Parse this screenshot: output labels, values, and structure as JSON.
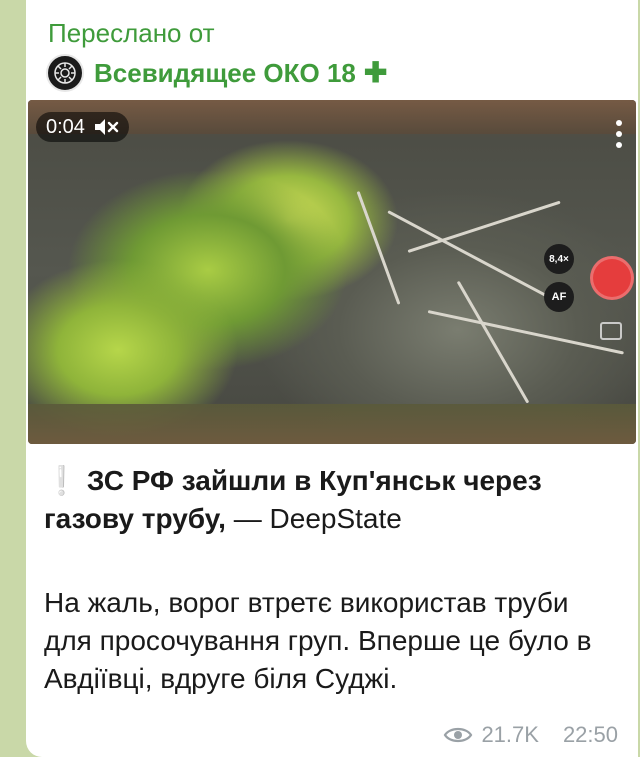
{
  "message": {
    "forwarded_label": "Переслано от",
    "channel_name": "Всевидящее ОКО 18",
    "channel_badge_icon": "plus-icon",
    "accent_color": "#3f9b3b"
  },
  "video": {
    "duration": "0:04",
    "muted_icon": "speaker-muted-icon",
    "zoom_label": "8,4×",
    "af_label": "AF"
  },
  "text": {
    "headline_icon": "exclamation-icon",
    "headline_bold": "ЗС РФ зайшли в Куп'янськ через газову трубу,",
    "headline_rest": " — DeepState",
    "body": "На жаль, ворог втретє використав труби для просочування груп. Вперше це було в Авдіївці, вдруге біля Суджі."
  },
  "stats": {
    "views": "21.7K",
    "time": "22:50"
  }
}
